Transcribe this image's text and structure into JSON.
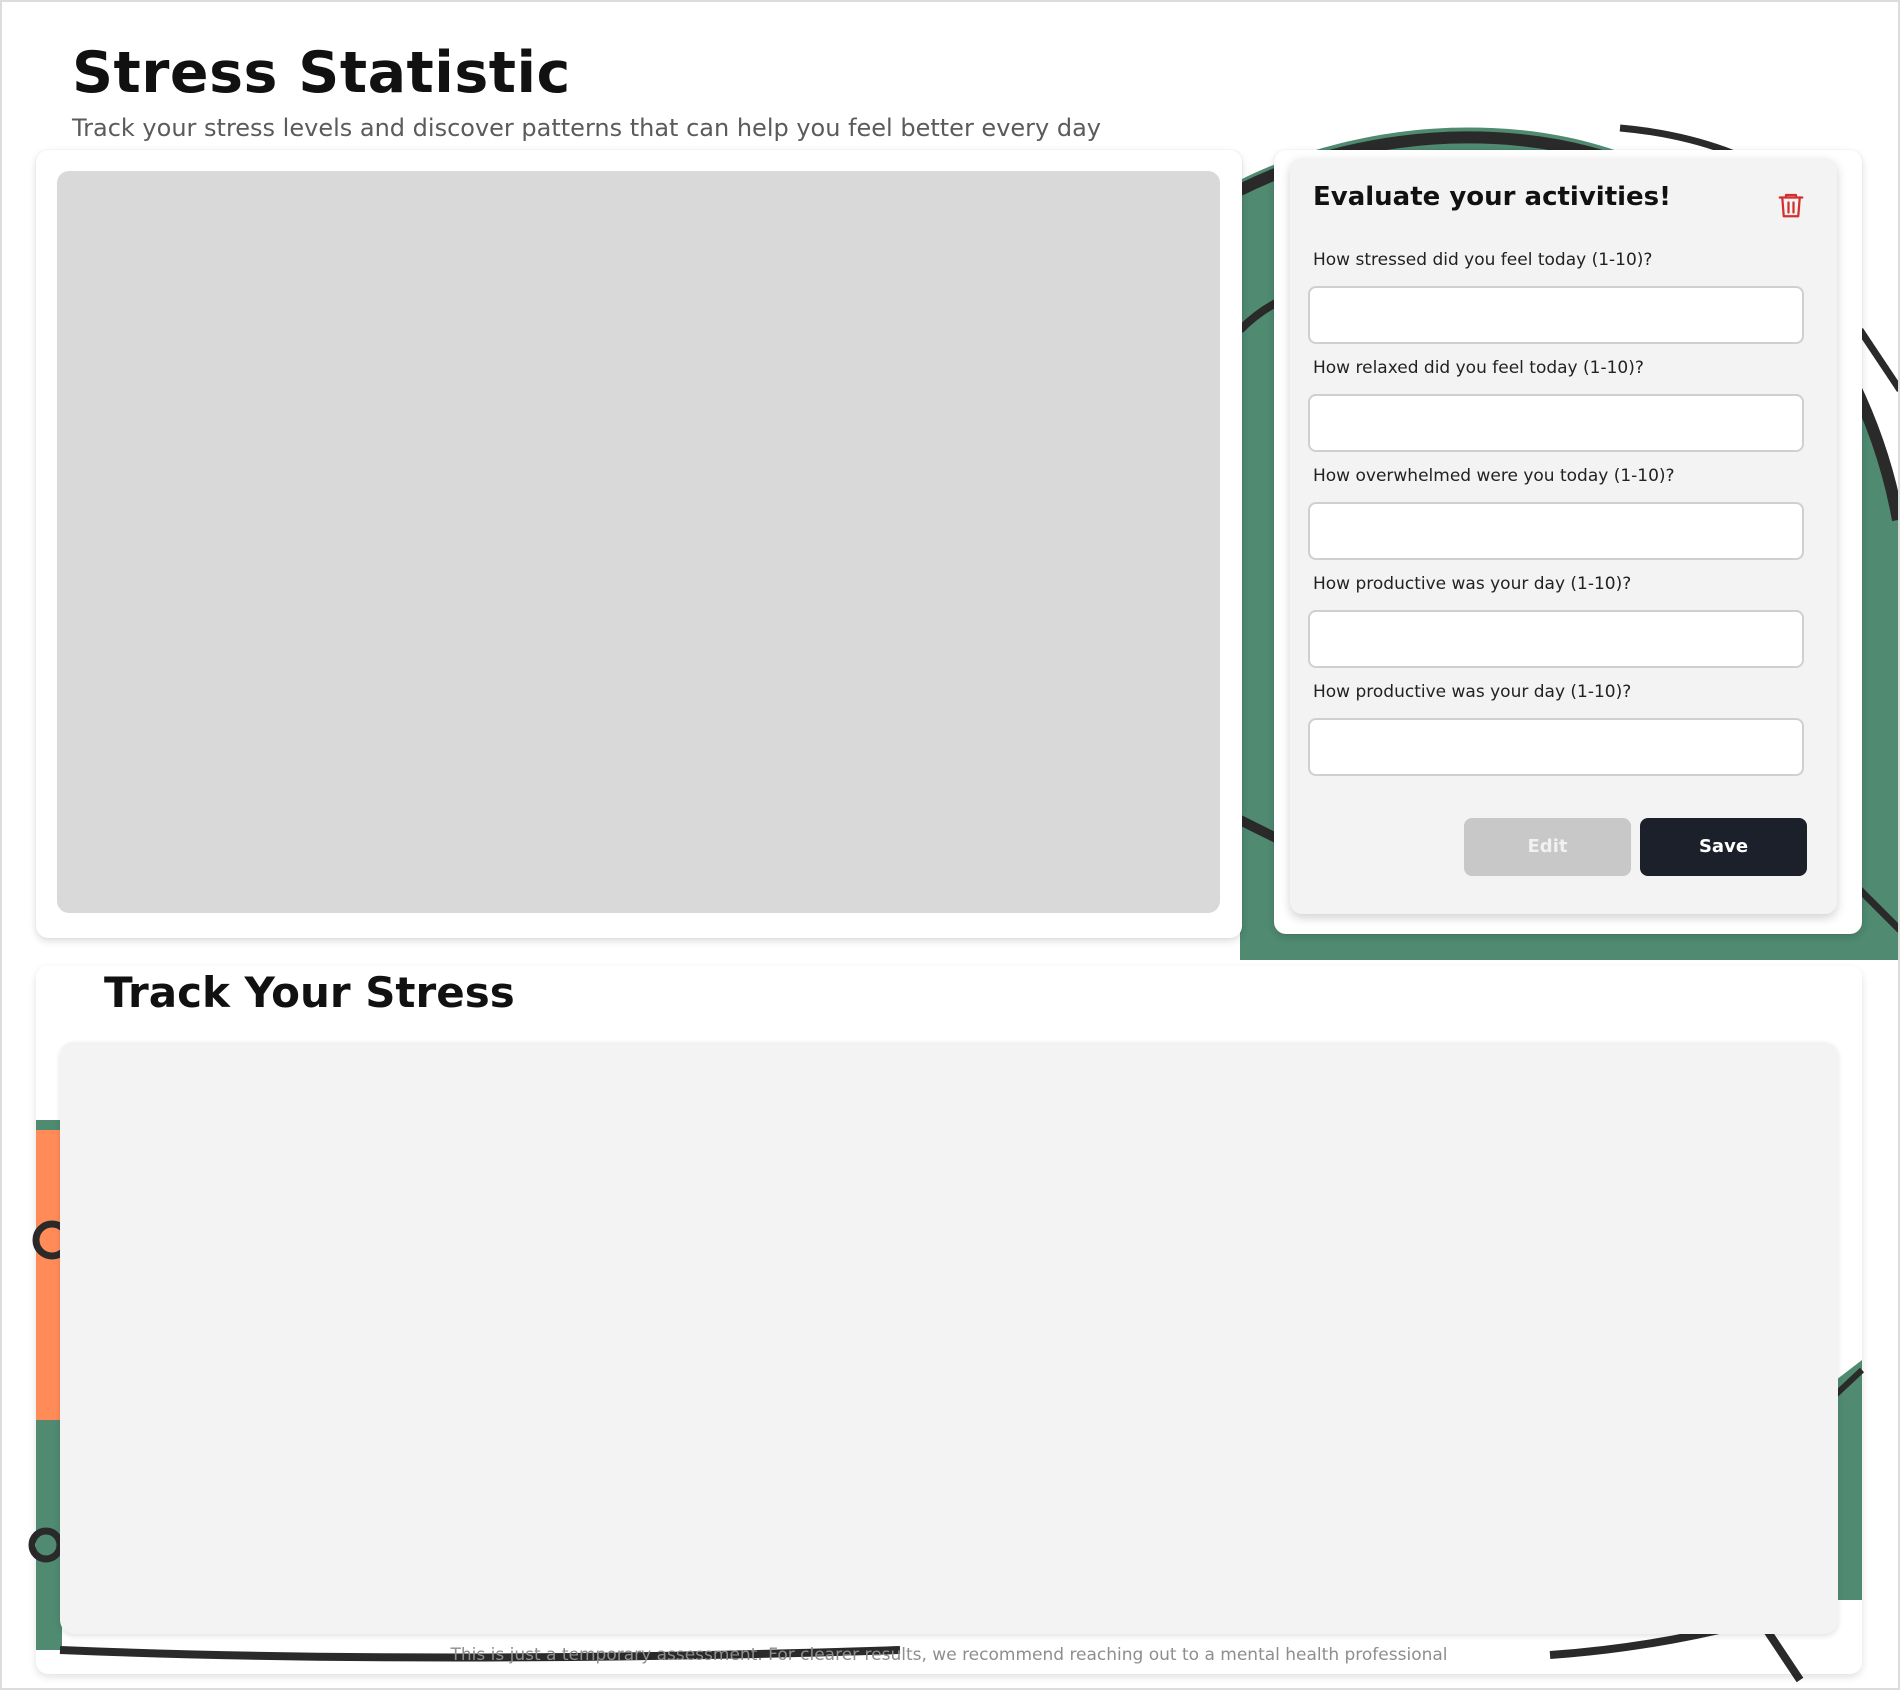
{
  "header": {
    "title": "Stress Statistic",
    "subtitle": "Track your stress levels and discover patterns that can help you feel better every day"
  },
  "evaluation_form": {
    "title": "Evaluate your activities!",
    "delete_icon": "trash-icon",
    "questions": [
      {
        "label": "How stressed did you feel today (1-10)?",
        "value": "",
        "placeholder": ""
      },
      {
        "label": "How relaxed did you feel today (1-10)?",
        "value": "",
        "placeholder": ""
      },
      {
        "label": "How overwhelmed were you today (1-10)?",
        "value": "",
        "placeholder": ""
      },
      {
        "label": "How productive was your day (1-10)?",
        "value": "",
        "placeholder": ""
      },
      {
        "label": "How productive was your day (1-10)?",
        "value": "",
        "placeholder": ""
      }
    ],
    "edit_label": "Edit",
    "save_label": "Save"
  },
  "tracker": {
    "title": "Track Your Stress",
    "footer_note": "This is just a temporary assessment. For clearer results, we recommend reaching out to a mental health professional"
  },
  "colors": {
    "delete_icon": "#d32f2f",
    "save_button": "#1b202b",
    "edit_button": "#c8c8c8",
    "decor_green": "#4f8a71",
    "decor_orange": "#ff8c58",
    "decor_outline": "#2a2a2a",
    "panel_gray": "#d9d9d9",
    "panel_light": "#f3f3f3"
  }
}
